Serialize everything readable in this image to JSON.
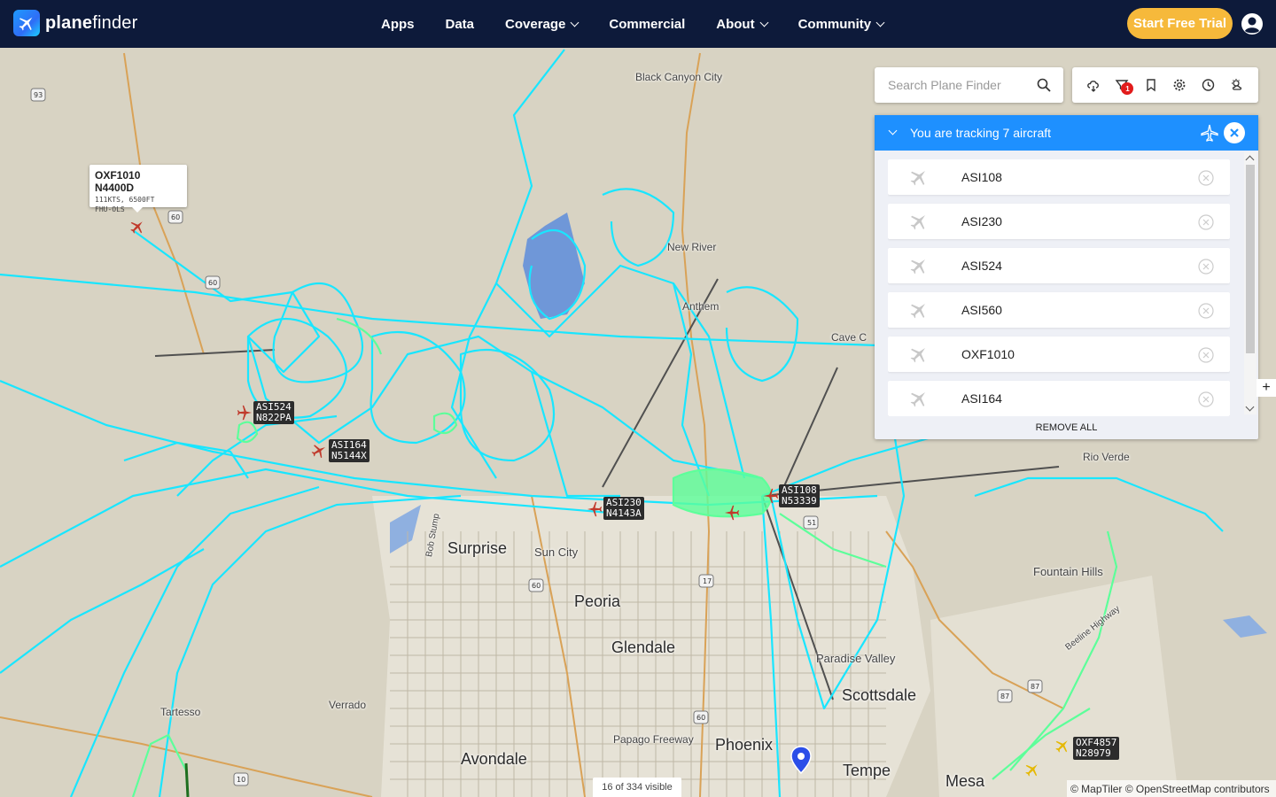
{
  "brand": {
    "name_bold": "plane",
    "name_rest": "finder"
  },
  "nav": [
    {
      "label": "Apps",
      "dropdown": false
    },
    {
      "label": "Data",
      "dropdown": false
    },
    {
      "label": "Coverage",
      "dropdown": true
    },
    {
      "label": "Commercial",
      "dropdown": false
    },
    {
      "label": "About",
      "dropdown": true
    },
    {
      "label": "Community",
      "dropdown": true
    }
  ],
  "cta_label": "Start Free Trial",
  "search": {
    "placeholder": "Search Plane Finder",
    "value": ""
  },
  "toolbar": {
    "icons": [
      "cloud-icon",
      "filter-icon",
      "bookmark-icon",
      "settings-icon",
      "history-icon",
      "weather-icon"
    ],
    "filter_badge": "1"
  },
  "tracking": {
    "title": "You are tracking 7 aircraft",
    "aircraft": [
      "ASI108",
      "ASI230",
      "ASI524",
      "ASI560",
      "OXF1010",
      "ASI164"
    ],
    "remove_all_label": "REMOVE ALL"
  },
  "popup": {
    "title": "OXF1010 N4400D",
    "line1": "111KTS, 6500FT",
    "line2": "FHU-OLS"
  },
  "aircraft_labels": [
    {
      "callsign": "ASI524",
      "reg": "N822PA"
    },
    {
      "callsign": "ASI164",
      "reg": "N5144X"
    },
    {
      "callsign": "ASI230",
      "reg": "N4143A"
    },
    {
      "callsign": "ASI108",
      "reg": "N53339"
    },
    {
      "callsign": "OXF4857",
      "reg": "N28979"
    }
  ],
  "places": {
    "black_canyon_city": "Black Canyon City",
    "new_river": "New River",
    "anthem": "Anthem",
    "cave_creek": "Cave C",
    "rio_verde": "Rio Verde",
    "fountain_hills": "Fountain Hills",
    "surprise": "Surprise",
    "sun_city": "Sun City",
    "peoria": "Peoria",
    "glendale": "Glendale",
    "paradise_valley": "Paradise Valley",
    "scottsdale": "Scottsdale",
    "phoenix": "Phoenix",
    "tempe": "Tempe",
    "mesa": "Mesa",
    "avondale": "Avondale",
    "verrado": "Verrado",
    "tartesso": "Tartesso",
    "papago": "Papago Freeway",
    "bob_stump": "Bob Stump",
    "beeline": "Beeline Highway"
  },
  "shields": [
    "93",
    "60",
    "60",
    "17",
    "51",
    "60",
    "87",
    "87",
    "10",
    "60"
  ],
  "status": {
    "visible": "16 of 334 visible"
  },
  "attribution": "© MapTiler © OpenStreetMap contributors",
  "colors": {
    "header": "#0d1a3a",
    "cta": "#f6b93b",
    "panel_header": "#1e90ff",
    "track_cyan": "#19e6ff",
    "track_green": "#5dff9a",
    "plane_red": "#c0392b"
  }
}
